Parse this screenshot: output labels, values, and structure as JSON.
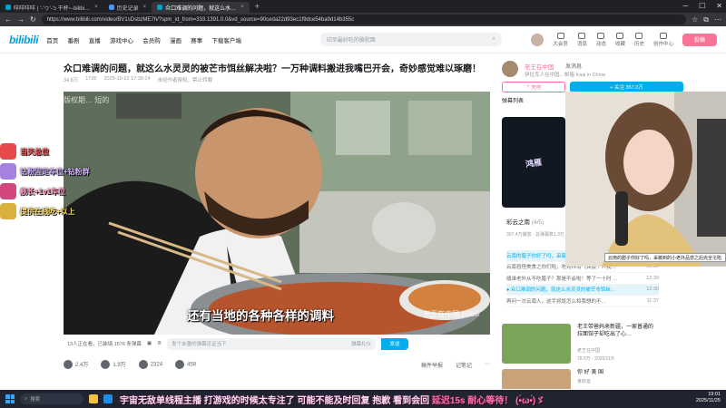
{
  "browser": {
    "tabs": [
      {
        "label": "咩咩咩咩 ( '-'ヮ'-'ɔ 干杯~-bilibi…",
        "active": false
      },
      {
        "label": "历史记录",
        "active": false
      },
      {
        "label": "众口难调的问题，就这么水…",
        "active": true
      }
    ],
    "new_tab": "+",
    "url": "https://www.bilibili.com/video/BV1sDsbzME7h/?spm_id_from=333.1391.0.0&vd_source=90ceda22d93ec1f9dce54ba9d14b355c"
  },
  "header": {
    "logo": "bilibili",
    "nav": [
      "首页",
      "番剧",
      "直播",
      "游戏中心",
      "会员购",
      "漫画",
      "赛事",
      "下载客户端"
    ],
    "search_placeholder": "印尼最好吃的骆驼面",
    "user_icons": [
      {
        "label": "大会员",
        "icon": "vip-icon"
      },
      {
        "label": "消息",
        "icon": "message-icon"
      },
      {
        "label": "动态",
        "icon": "dynamic-icon"
      },
      {
        "label": "收藏",
        "icon": "favorite-icon"
      },
      {
        "label": "历史",
        "icon": "history-icon"
      },
      {
        "label": "创作中心",
        "icon": "creator-icon"
      }
    ],
    "badges": {
      "message": "2",
      "dynamic": "1"
    },
    "upload_label": "投稿",
    "brand_color": "#00a1d6",
    "accent_color": "#fb7299"
  },
  "video": {
    "title": "众口难调的问题，就这么水灵灵的被芒市饵丝解决啦？一万种调料搬进我嘴巴开会，奇妙感觉难以琢磨！",
    "views": "34.8万",
    "danmaku_count": "1726",
    "date": "2025-10-22 17:36:14",
    "warning": "未经作者授权，禁止转载",
    "subtitle": "还有当地的各种各样的调料",
    "watermark": "老王在中国 bilibili",
    "overlay_text": "版权期… 短的",
    "online": "13人正在看，已装填 1576 条弹幕",
    "danmaku_placeholder": "发个友善的弹幕见证当下",
    "danmaku_etiquette": "弹幕礼仪",
    "send_label": "发送",
    "likes": "2.4万",
    "coins": "1.9万",
    "favorites": "2324",
    "shares": "458",
    "report_label": "稿件举报",
    "notes_label": "记笔记"
  },
  "uploader": {
    "name": "老王在中国",
    "message_label": "发消息",
    "desc": "伊拉克人在中国，邮箱 Iraqi in China",
    "charge_label": "充电",
    "follow_label": "+ 关注 357.0万"
  },
  "danmaku_list": {
    "title": "弹幕列表"
  },
  "collection": {
    "card_text": "鸿雁",
    "title": "彩云之南",
    "count": "(4/5)",
    "meta": "307.4万播放 · 总弹幕数1.3万 · 2025-10-25"
  },
  "collection_items": [
    {
      "text": "云南的腊子你好了吗，采薇到的小老外",
      "time": "",
      "highlight": true
    },
    {
      "text": "云南吞怪美食之你们啦，吃完神清气爽服个人我…",
      "time": "10:59",
      "highlight": false
    },
    {
      "text": "缝谁老外从不吃腊子？那是不会啦！等了一十时 …",
      "time": "12:39",
      "highlight": false
    },
    {
      "text": "● 众口难调的问题，就这么水灵灵的被芒市饵丝…",
      "time": "12:30",
      "highlight": true
    },
    {
      "text": "再问一次云南人，这手抓饭怎么和我想的不…",
      "time": "11:37",
      "highlight": false
    }
  ],
  "recommendations": [
    {
      "title": "老王带爸妈来新疆，一家普通的拉面馆子却吃出了心…",
      "author": "老王在中国",
      "stats": "78.8万 · 2025/11/5",
      "thumb_color": "#7ca45a"
    },
    {
      "title": "你 好 美 国",
      "author": "食启宜",
      "stats": "366.5万 · 2025/11/5",
      "thumb_color": "#c9a27a"
    }
  ],
  "stream_overlay": {
    "caption": "云南的腊子你好了吗，采薇到的小老外品尝之后完全沦陷",
    "gifts": [
      {
        "text": "当天总位",
        "color": "#e64a4a"
      },
      {
        "text": "钻粉固定车位+钻粉群",
        "color": "#c9a5ff"
      },
      {
        "text": "舰长+1v1车位",
        "color": "#ff8fb8"
      },
      {
        "text": "提供在线吃+以上",
        "color": "#ffd65a"
      }
    ],
    "marquee": "宇宙无敌单线程主播 打游戏的时候太专注了 可能不能及时回复 抱歉 看到会回",
    "marquee_highlight": "延迟15s 耐心等待！ (•̀ω•́)ゞ"
  },
  "taskbar": {
    "search": "搜索",
    "time": "19:01",
    "date": "2025/11/25"
  }
}
